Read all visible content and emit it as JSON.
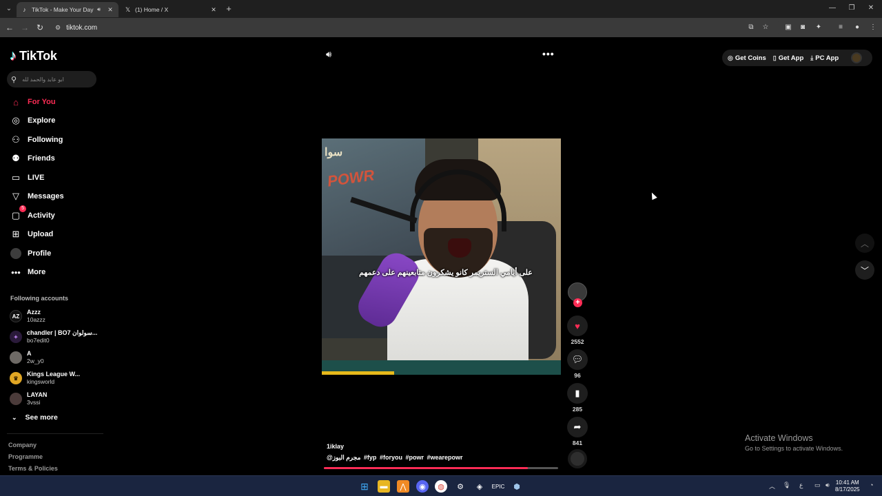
{
  "browser": {
    "tabs": [
      {
        "title": "TikTok - Make Your Day",
        "active": true,
        "icon": "tiktok-icon",
        "audio": true
      },
      {
        "title": "(1) Home / X",
        "active": false,
        "icon": "x-icon"
      }
    ],
    "url": "tiktok.com"
  },
  "sidebar": {
    "logo": "TikTok",
    "search_placeholder": "ابو عابد والحمد لله",
    "nav": [
      {
        "label": "For You",
        "icon": "home-icon",
        "active": true
      },
      {
        "label": "Explore",
        "icon": "compass-icon"
      },
      {
        "label": "Following",
        "icon": "following-icon"
      },
      {
        "label": "Friends",
        "icon": "friends-icon"
      },
      {
        "label": "LIVE",
        "icon": "live-icon"
      },
      {
        "label": "Messages",
        "icon": "messages-icon"
      },
      {
        "label": "Activity",
        "icon": "activity-icon",
        "badge": "5"
      },
      {
        "label": "Upload",
        "icon": "upload-icon"
      },
      {
        "label": "Profile",
        "icon": "profile-avatar"
      },
      {
        "label": "More",
        "icon": "more-icon"
      }
    ],
    "following_title": "Following accounts",
    "accounts": [
      {
        "name": "Azzz",
        "handle": "10azzz"
      },
      {
        "name": "chandler | BO7 ‎‏سولوان...",
        "handle": "bo7edit0"
      },
      {
        "name": "A",
        "handle": "2w_y0"
      },
      {
        "name": "Kings League W...",
        "handle": "kingsworld"
      },
      {
        "name": "LAYAN",
        "handle": "3vssi"
      }
    ],
    "see_more": "See more",
    "footer": [
      "Company",
      "Programme",
      "Terms & Policies"
    ]
  },
  "topright": {
    "get_coins": "Get Coins",
    "get_app": "Get App",
    "pc_app": "PC App"
  },
  "video": {
    "caption": "على أيامي الستريمر كانو يشكرون متابعينهم على دعمهم",
    "author": "1iklay",
    "mention": "@مجرم البوز",
    "hashtags": [
      "#fyp",
      "#foryou",
      "#powr",
      "#wearepowr"
    ],
    "progress": 0.87,
    "likes": "2552",
    "comments": "96",
    "saves": "285",
    "shares": "841"
  },
  "watermark": {
    "title": "Activate Windows",
    "subtitle": "Go to Settings to activate Windows."
  },
  "taskbar": {
    "time": "10:41 AM",
    "date": "8/17/2025",
    "lang": "ع"
  },
  "colors": {
    "accent": "#fe2c55",
    "bg": "#000000",
    "panel": "#1e1e1e"
  }
}
